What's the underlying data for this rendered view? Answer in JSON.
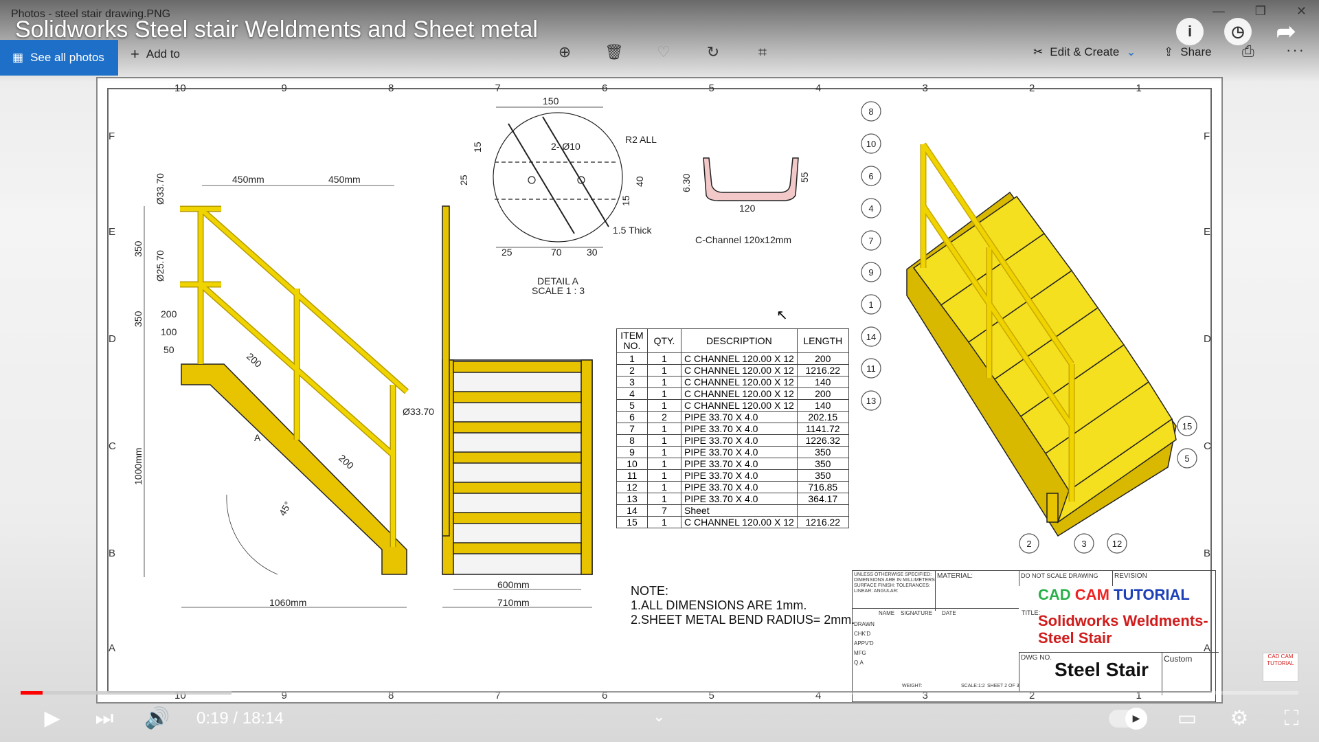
{
  "window": {
    "title": "Photos - steel stair drawing.PNG",
    "minimize": "—",
    "restore": "❐",
    "close": "✕"
  },
  "video": {
    "title": "Solidworks Steel stair Weldments and Sheet metal"
  },
  "photos_bar": {
    "see_all": "See all photos",
    "add_to": "Add to",
    "edit_create": "Edit & Create",
    "share": "Share"
  },
  "drawing": {
    "zones_top": [
      "10",
      "9",
      "8",
      "7",
      "6",
      "5",
      "4",
      "3",
      "2",
      "1"
    ],
    "zones_side": [
      "F",
      "E",
      "D",
      "C",
      "B",
      "A"
    ],
    "dims": {
      "rail_top": "450mm",
      "rail_top2": "450mm",
      "d1": "Ø33.70",
      "d2": "Ø25.70",
      "v350a": "350",
      "v350b": "350",
      "s200": "200",
      "s100": "100",
      "s50": "50",
      "h1000": "1000mm",
      "w1060": "1060mm",
      "a200a": "200",
      "a200b": "200",
      "ang": "45°",
      "labelA": "A",
      "d3": "Ø33.70",
      "w600": "600mm",
      "w710": "710mm"
    },
    "detail": {
      "d150": "150",
      "r2": "R2 ALL",
      "holes": "2- Ø10",
      "v15a": "15",
      "v25": "25",
      "v40": "40",
      "v15b": "15",
      "thick": "1.5 Thick",
      "b25": "25",
      "b70": "70",
      "b30": "30",
      "label": "DETAIL A",
      "scale": "SCALE 1 : 3"
    },
    "channel": {
      "w": "120",
      "h": "55",
      "t": "6.30",
      "label": "C-Channel 120x12mm"
    },
    "balloons": [
      "8",
      "10",
      "6",
      "4",
      "7",
      "9",
      "1",
      "14",
      "11",
      "13",
      "15",
      "5",
      "2",
      "3",
      "12"
    ]
  },
  "bom": {
    "headers": [
      "ITEM NO.",
      "QTY.",
      "DESCRIPTION",
      "LENGTH"
    ],
    "rows": [
      [
        "1",
        "1",
        "C CHANNEL 120.00 X 12",
        "200"
      ],
      [
        "2",
        "1",
        "C CHANNEL 120.00 X 12",
        "1216.22"
      ],
      [
        "3",
        "1",
        "C CHANNEL 120.00 X 12",
        "140"
      ],
      [
        "4",
        "1",
        "C CHANNEL 120.00 X 12",
        "200"
      ],
      [
        "5",
        "1",
        "C CHANNEL 120.00 X 12",
        "140"
      ],
      [
        "6",
        "2",
        "PIPE 33.70 X 4.0",
        "202.15"
      ],
      [
        "7",
        "1",
        "PIPE 33.70 X 4.0",
        "1141.72"
      ],
      [
        "8",
        "1",
        "PIPE 33.70 X 4.0",
        "1226.32"
      ],
      [
        "9",
        "1",
        "PIPE 33.70 X 4.0",
        "350"
      ],
      [
        "10",
        "1",
        "PIPE 33.70 X 4.0",
        "350"
      ],
      [
        "11",
        "1",
        "PIPE 33.70 X 4.0",
        "350"
      ],
      [
        "12",
        "1",
        "PIPE 33.70 X 4.0",
        "716.85"
      ],
      [
        "13",
        "1",
        "PIPE 33.70 X 4.0",
        "364.17"
      ],
      [
        "14",
        "7",
        "Sheet",
        ""
      ],
      [
        "15",
        "1",
        "C CHANNEL 120.00 X 12",
        "1216.22"
      ]
    ]
  },
  "note": {
    "line0": "NOTE:",
    "line1": "1.ALL DIMENSIONS ARE 1mm.",
    "line2": "2.SHEET METAL BEND RADIUS= 2mm."
  },
  "title_block": {
    "unless": "UNLESS OTHERWISE SPECIFIED: DIMENSIONS ARE IN MILLIMETERS SURFACE FINISH: TOLERANCES: LINEAR: ANGULAR:",
    "material": "MATERIAL:",
    "do_not_scale": "DO NOT SCALE DRAWING",
    "revision": "REVISION",
    "brand1": "CAD",
    "brand2": "CAM",
    "brand3": "TUTORIAL",
    "title_label": "TITLE:",
    "title_line1": "Solidworks Weldments-",
    "title_line2": "Steel Stair",
    "dwg_label": "DWG NO.",
    "dwg": "Steel Stair",
    "custom": "Custom",
    "cols": [
      "NAME",
      "SIGNATURE",
      "DATE"
    ],
    "rows": [
      "DRAWN",
      "CHK'D",
      "APPV'D",
      "MFG",
      "Q.A"
    ],
    "weight": "WEIGHT:",
    "scale": "SCALE:1:2",
    "sheet": "SHEET 2 OF 3"
  },
  "player": {
    "time": "0:19 / 18:14",
    "progress": 0.017,
    "loaded": 0.165
  },
  "channel_logo": {
    "l1": "CAD CAM",
    "l2": "TUTORIAL"
  }
}
